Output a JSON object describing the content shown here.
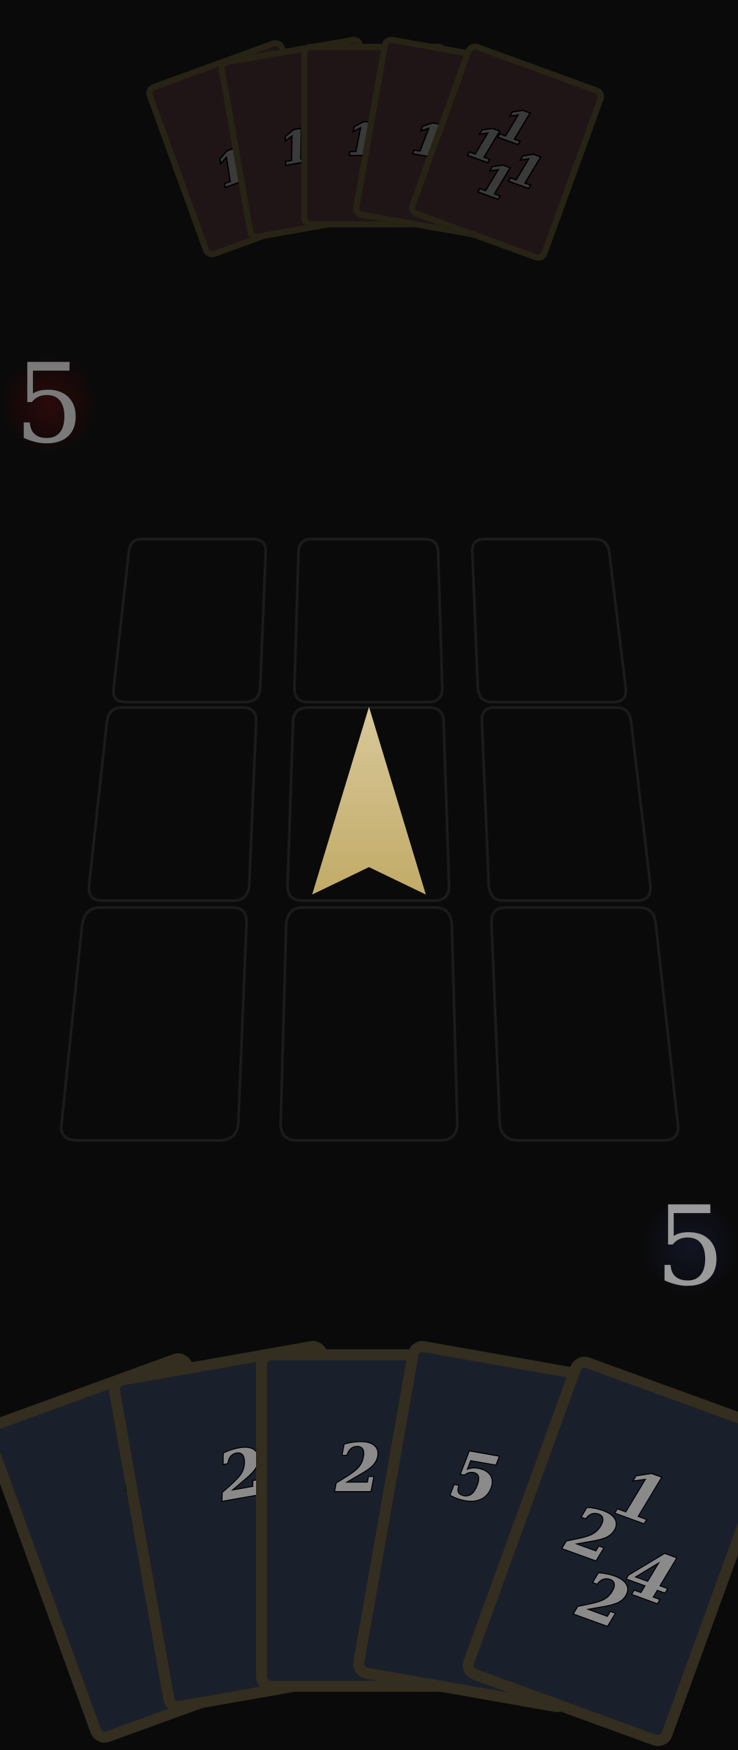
{
  "board": {
    "empty_slots": 8,
    "colors": {
      "background": "#0a0a0a",
      "slot_outline": "#1b1b1b",
      "arrow_top": "#d8c89a",
      "arrow_bottom": "#c2ab67"
    }
  },
  "scores": {
    "opponent": "5",
    "player": "5"
  },
  "opponent_hand": {
    "count": 5,
    "card_back_color": "#1f1516",
    "visible_card": {
      "top": "1",
      "left": "1",
      "right": "1",
      "bottom": "1"
    },
    "partial_labels": [
      "1",
      "1",
      "1",
      "1"
    ]
  },
  "player_hand": {
    "count": 5,
    "card_color": "#1a202b",
    "visible_card": {
      "top": "1",
      "left": "2",
      "right": "4",
      "bottom": "2"
    },
    "partial_labels": [
      "1",
      "2",
      "2",
      "5"
    ]
  }
}
